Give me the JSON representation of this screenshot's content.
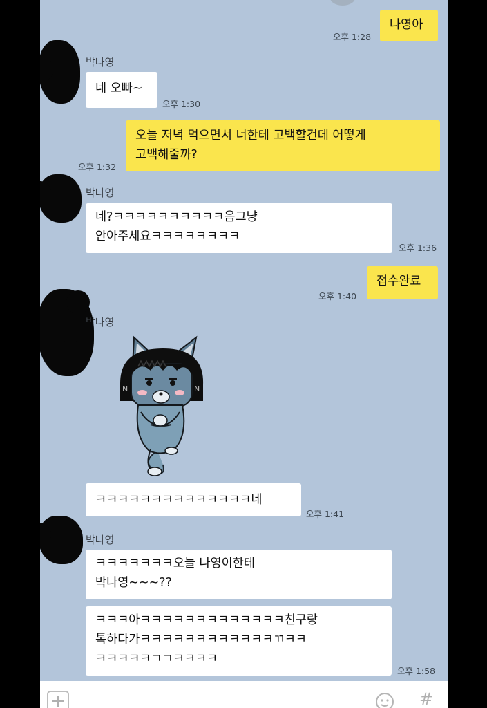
{
  "chat": {
    "partner_name": "박나영",
    "messages": [
      {
        "text": "나영아",
        "time": "오후 1:28"
      },
      {
        "text": "네 오빠~",
        "time": "오후 1:30"
      },
      {
        "text": "오늘 저녁 먹으면서 너한테 고백할건데 어떻게\n고백해줄까?",
        "time": "오후 1:32"
      },
      {
        "text": "네?ㅋㅋㅋㅋㅋㅋㅋㅋㅋㅋ음그냥\n안아주세요ㅋㅋㅋㅋㅋㅋㅋㅋ",
        "time": "오후 1:36"
      },
      {
        "text": "접수완료",
        "time": "오후 1:40"
      },
      {
        "text": "ㅋㅋㅋㅋㅋㅋㅋㅋㅋㅋㅋㅋㅋㅋ네",
        "time": "오후 1:41"
      },
      {
        "text": "ㅋㅋㅋㅋㅋㅋㅋ오늘 나영이한테\n박나영~~~??"
      },
      {
        "text": "ㅋㅋㅋ아ㅋㅋㅋㅋㅋㅋㅋㅋㅋㅋㅋㅋㅋ친구랑\n톡하다가ㅋㅋㅋㅋㅋㅋㅋㅋㅋㅋㅋㅋㄲㅋㅋ\nㅋㅋㅋㅋㅋㄱㄱㅋㅋㅋㅋ",
        "time": "오후 1:58"
      }
    ],
    "sticker_icon": "cat-character-sticker"
  },
  "input_bar": {
    "icons": [
      "add-icon",
      "emoji-icon",
      "hashtag-icon"
    ],
    "hash_symbol": "#"
  },
  "colors": {
    "background": "#b3c5da",
    "outgoing_bubble": "#fae54d",
    "incoming_bubble": "#ffffff"
  }
}
